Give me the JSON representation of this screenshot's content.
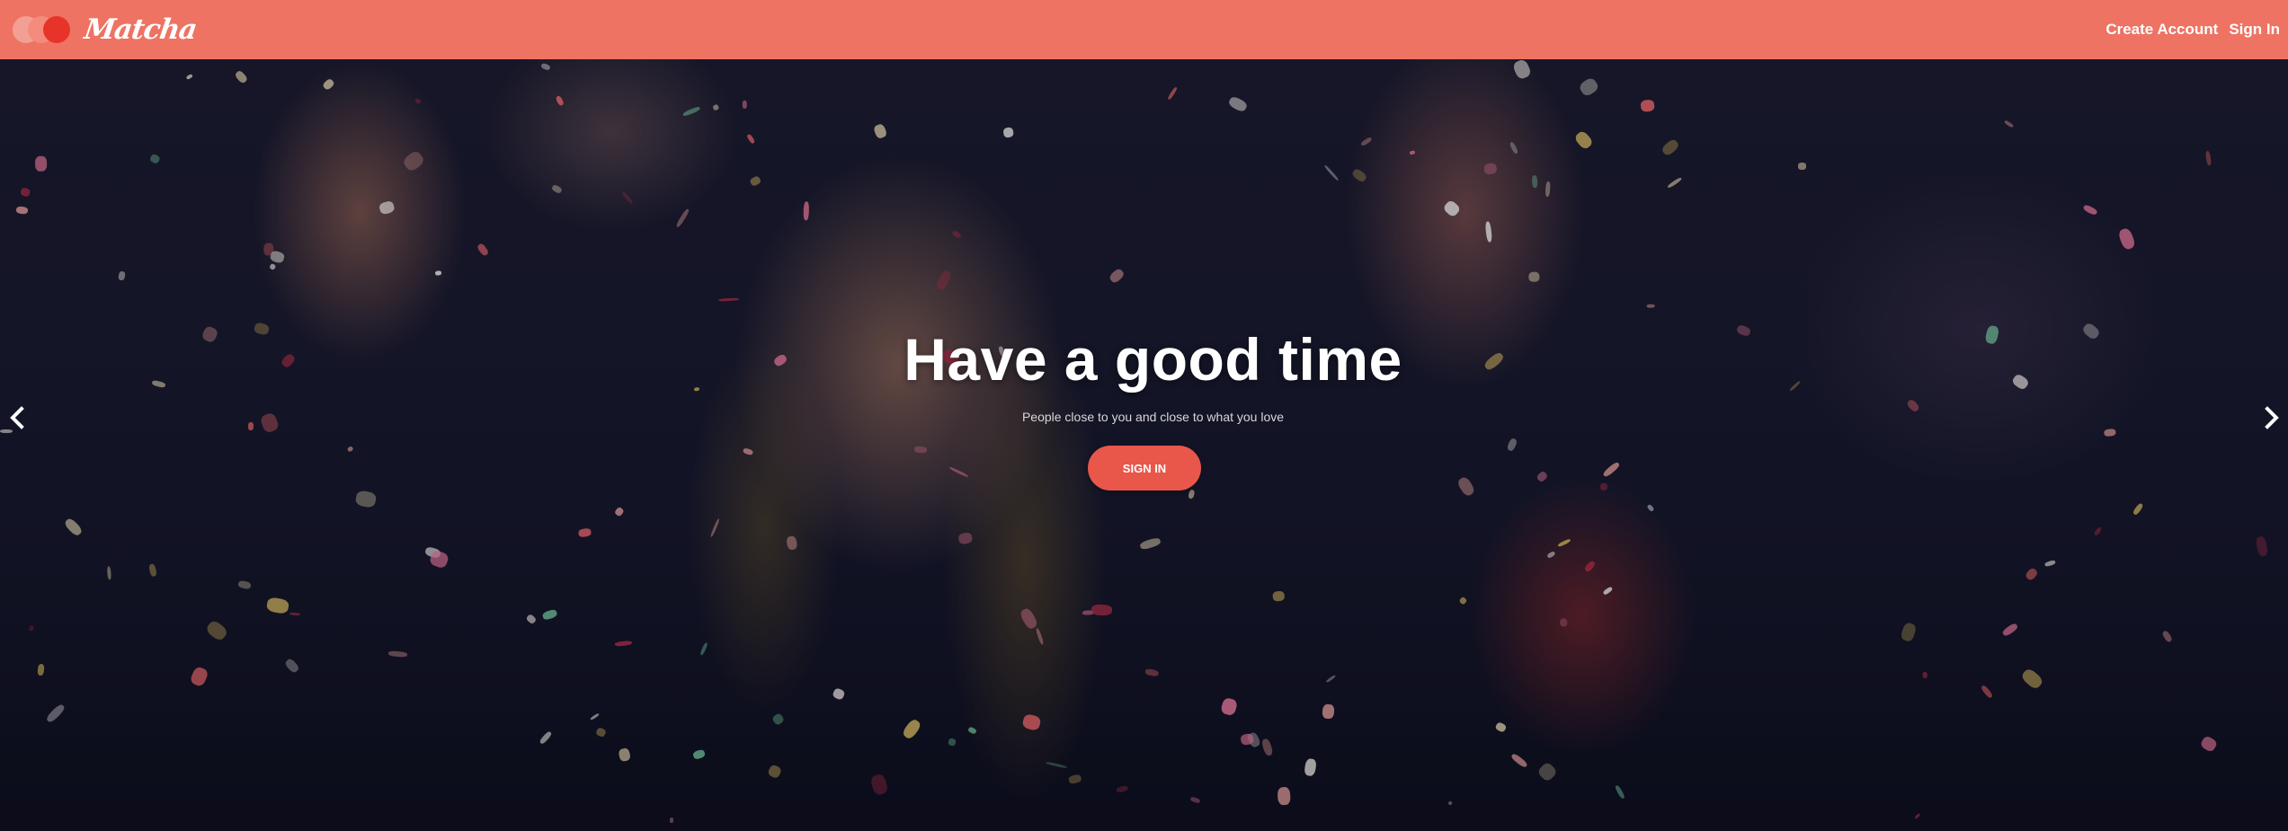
{
  "brand": {
    "name": "Matcha",
    "icon": "three-overlapping-circles-logo",
    "colors": [
      "#f2a093",
      "#f48b7c",
      "#e8332b"
    ]
  },
  "nav": {
    "create_account": "Create Account",
    "sign_in": "Sign In"
  },
  "hero": {
    "title": "Have a good time",
    "subtitle": "People close to you and close to what you love",
    "cta_label": "SIGN IN"
  },
  "carousel": {
    "prev_icon": "chevron-left-icon",
    "next_icon": "chevron-right-icon"
  },
  "colors": {
    "navbar": "#ee7363",
    "button": "#e8574a",
    "text": "#ffffff"
  }
}
